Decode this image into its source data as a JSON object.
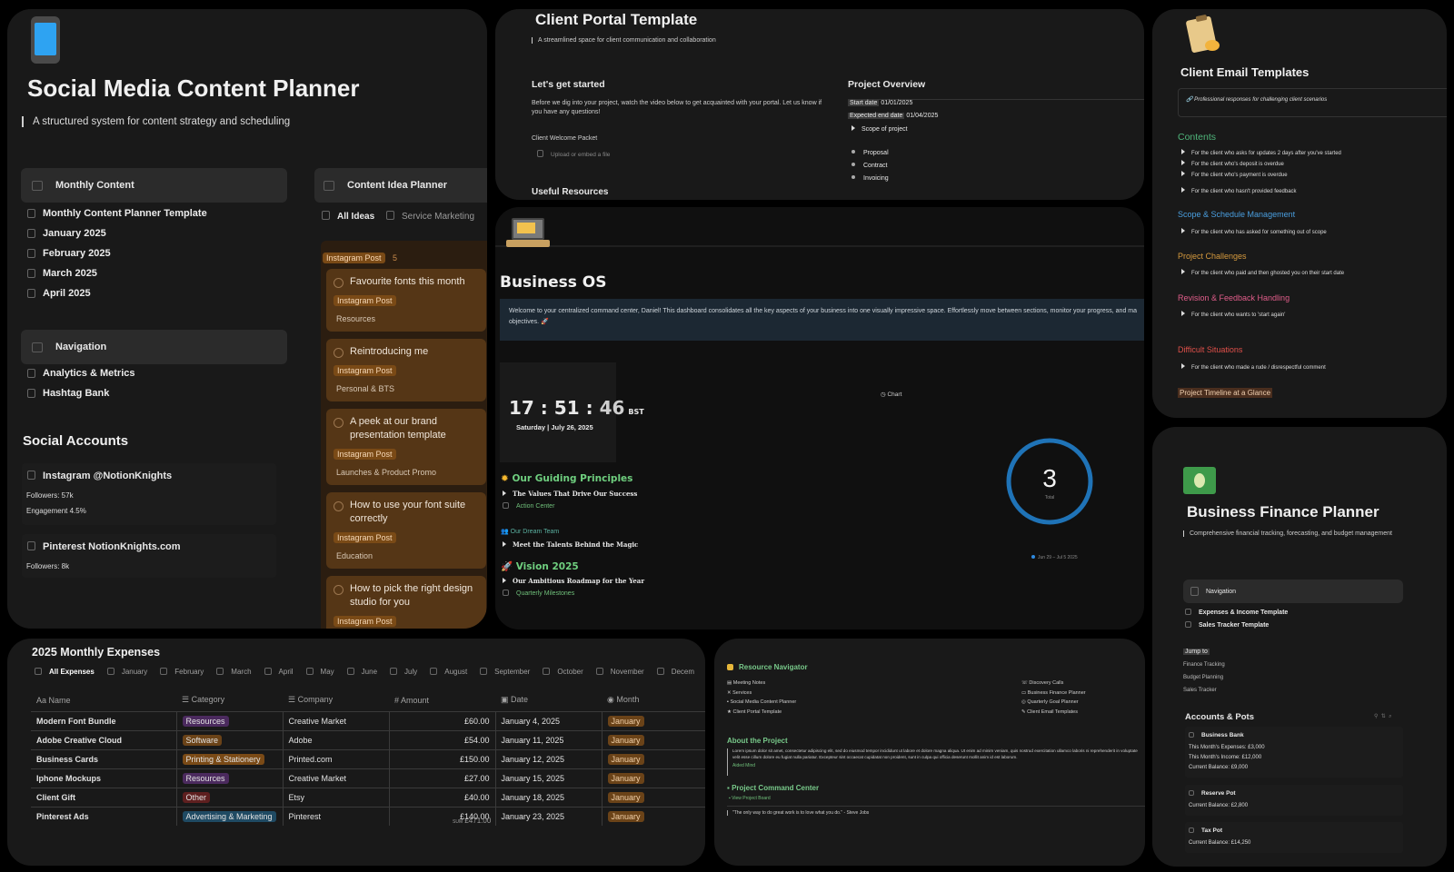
{
  "social": {
    "title": "Social Media Content Planner",
    "subtitle": "A structured system for content strategy and scheduling",
    "monthly_heading": "Monthly Content",
    "monthly_items": [
      "Monthly Content Planner Template",
      "January 2025",
      "February 2025",
      "March 2025",
      "April 2025"
    ],
    "nav_heading": "Navigation",
    "nav_items": [
      "Analytics & Metrics",
      "Hashtag Bank"
    ],
    "accounts_heading": "Social Accounts",
    "accounts": [
      {
        "name": "Instagram @NotionKnights",
        "lines": [
          "Followers: 57k",
          "Engagement 4.5%"
        ]
      },
      {
        "name": "Pinterest NotionKnights.com",
        "lines": [
          "Followers: 8k"
        ]
      }
    ],
    "ideas_heading": "Content Idea Planner",
    "idea_tabs": [
      "All Ideas",
      "Service Marketing"
    ],
    "group_label": "Instagram Post",
    "group_count": "5",
    "ideas": [
      {
        "title": "Favourite fonts this month",
        "tag": "Instagram Post",
        "sub": "Resources"
      },
      {
        "title": "Reintroducing me",
        "tag": "Instagram Post",
        "sub": "Personal & BTS"
      },
      {
        "title": "A peek at our brand presentation template",
        "tag": "Instagram Post",
        "sub": "Launches & Product Promo"
      },
      {
        "title": "How to use your font suite correctly",
        "tag": "Instagram Post",
        "sub": "Education"
      },
      {
        "title": "How to pick the right design studio for you",
        "tag": "Instagram Post",
        "sub": ""
      }
    ]
  },
  "portal": {
    "title": "Client Portal Template",
    "subtitle": "A streamlined space for client communication and collaboration",
    "start_heading": "Let's get started",
    "start_body": "Before we dig into your project, watch the video below to get acquainted with your portal. Let us know if you have any questions!",
    "packet_label": "Client Welcome Packet",
    "upload_label": "Upload or embed a file",
    "resources_heading": "Useful Resources",
    "overview_heading": "Project Overview",
    "start_date_label": "Start date",
    "start_date": "01/01/2025",
    "end_date_label": "Expected end date",
    "end_date": "01/04/2025",
    "scope_label": "Scope of project",
    "scope_items": [
      "Proposal",
      "Contract",
      "Invoicing"
    ]
  },
  "business_os": {
    "title": "Business OS",
    "welcome": "Welcome to your centralized command center, Daniel! This dashboard consolidates all the key aspects of your business into one visually impressive space. Effortlessly move between sections, monitor your progress, and ma",
    "welcome_line2": "objectives. 🚀",
    "clock_time": {
      "h": "17",
      "m": "51",
      "s": "46"
    },
    "clock_zone": "BST",
    "clock_date": "Saturday | July 26, 2025",
    "chart_label": "Chart",
    "ring_value": "3",
    "ring_caption": "Total",
    "ring_legend": "Jun 29 – Jul 5 2025",
    "principles_heading": "Our Guiding Principles",
    "principles_toggle": "The Values That Drive Our Success",
    "action_center": "Action Center",
    "dream_team": "Our Dream Team",
    "talents_toggle": "Meet the Talents Behind the Magic",
    "vision_heading": "Vision 2025",
    "vision_toggle": "Our Ambitious Roadmap for the Year",
    "milestones": "Quarterly Milestones"
  },
  "email": {
    "title": "Client Email Templates",
    "callout": "Professional responses for challenging client scenarios",
    "contents_heading": "Contents",
    "contents_items": [
      "For the client who asks for updates 2 days after you've started",
      "For the client who's deposit is overdue",
      "For the client who's payment is overdue",
      "For the client who hasn't provided feedback"
    ],
    "scope_heading": "Scope & Schedule Management",
    "scope_items": [
      "For the client who has asked for something out of scope"
    ],
    "challenges_heading": "Project Challenges",
    "challenges_items": [
      "For the client who paid and then ghosted you on their start date"
    ],
    "revision_heading": "Revision & Feedback Handling",
    "revision_items": [
      "For the client who wants to 'start again'"
    ],
    "difficult_heading": "Difficult Situations",
    "difficult_items": [
      "For the client who made a rude / disrespectful comment"
    ],
    "timeline_label": "Project Timeline at a Glance",
    "colors": {
      "contents": "#4fb57a",
      "scope": "#4a9fe0",
      "challenges": "#d69a3e",
      "revision": "#e05d8a",
      "difficult": "#e0504a"
    }
  },
  "finance": {
    "title": "Business Finance Planner",
    "subtitle": "Comprehensive financial tracking, forecasting, and budget management",
    "nav_heading": "Navigation",
    "nav_items": [
      "Expenses & Income Template",
      "Sales Tracker Template"
    ],
    "jump_label": "Jump to",
    "jump_items": [
      "Finance Tracking",
      "Budget Planning",
      "Sales Tracker"
    ],
    "accounts_heading": "Accounts & Pots",
    "pots": [
      {
        "name": "Business Bank",
        "lines": [
          "This Month's Expenses: £3,000",
          "This Month's Income: £12,000",
          "Current Balance: £9,000"
        ]
      },
      {
        "name": "Reserve Pot",
        "lines": [
          "Current Balance: £2,800"
        ]
      },
      {
        "name": "Tax Pot",
        "lines": [
          "Current Balance: £14,250"
        ]
      }
    ]
  },
  "expenses": {
    "title": "2025 Monthly Expenses",
    "tabs": [
      "All Expenses",
      "January",
      "February",
      "March",
      "April",
      "May",
      "June",
      "July",
      "August",
      "September",
      "October",
      "November",
      "Decem"
    ],
    "columns": [
      "Name",
      "Category",
      "Company",
      "Amount",
      "Date",
      "Month"
    ],
    "rows": [
      {
        "name": "Modern Font Bundle",
        "category": "Resources",
        "cat_color": "#4b2a5e",
        "company": "Creative Market",
        "amount": "£60.00",
        "date": "January 4, 2025",
        "month": "January"
      },
      {
        "name": "Adobe Creative Cloud",
        "category": "Software",
        "cat_color": "#6b4318",
        "company": "Adobe",
        "amount": "£54.00",
        "date": "January 11, 2025",
        "month": "January"
      },
      {
        "name": "Business Cards",
        "category": "Printing & Stationery",
        "cat_color": "#7a4a16",
        "company": "Printed.com",
        "amount": "£150.00",
        "date": "January 12, 2025",
        "month": "January"
      },
      {
        "name": "Iphone Mockups",
        "category": "Resources",
        "cat_color": "#4b2a5e",
        "company": "Creative Market",
        "amount": "£27.00",
        "date": "January 15, 2025",
        "month": "January"
      },
      {
        "name": "Client Gift",
        "category": "Other",
        "cat_color": "#5e1f1f",
        "company": "Etsy",
        "amount": "£40.00",
        "date": "January 18, 2025",
        "month": "January"
      },
      {
        "name": "Pinterest Ads",
        "category": "Advertising & Marketing",
        "cat_color": "#1f4a63",
        "company": "Pinterest",
        "amount": "£140.00",
        "date": "January 23, 2025",
        "month": "January"
      }
    ],
    "sum_label": "SUM",
    "sum_value": "£471.00"
  },
  "navigator": {
    "heading": "Resource Navigator",
    "left_links": [
      "Meeting Notes",
      "Services",
      "Social Media Content Planner",
      "Client Portal Template"
    ],
    "right_links": [
      "Discovery Calls",
      "Business Finance Planner",
      "Quarterly Goal Planner",
      "Client Email Templates"
    ],
    "about_heading": "About the Project",
    "about_text": "Lorem ipsum dolor sit amet, consectetur adipiscing elit, sed do eiusmod tempor incididunt ut labore et dolore magna aliqua. Ut enim ad minim veniam, quis nostrud exercitation ullamco laboris ni reprehenderit in voluptate velit esse cillum dolore eu fugiat nulla pariatur. Excepteur sint occaecat cupidatat non proident, sunt in culpa qui officia deserunt mollit anim id est laborum.",
    "about_link": "Aided Mind",
    "command_heading": "Project Command Center",
    "command_link": "View Project Board",
    "quote": "\"The only way to do great work is to love what you do.\" - Steve Jobs"
  }
}
